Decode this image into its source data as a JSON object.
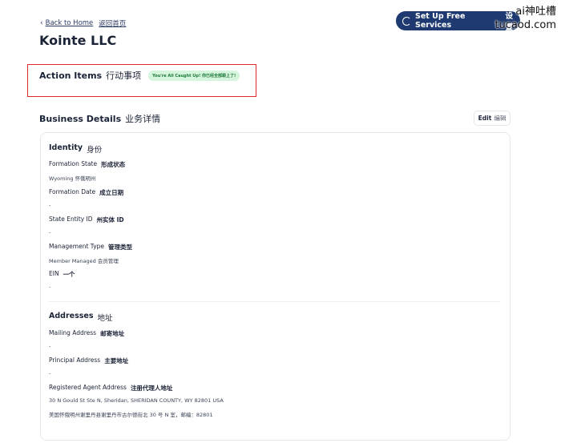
{
  "nav": {
    "back_label": "Back to Home",
    "back_label_cn": "返回首页",
    "back_icon": "chevron-left-icon"
  },
  "page": {
    "title": "Kointe LLC"
  },
  "header_button": {
    "label": "Set Up Free Services",
    "label_cn": "设置",
    "icon": "spinner-icon",
    "color": "#1e3a70"
  },
  "watermark": {
    "line1": "ai神吐槽",
    "line2": "tucaod.com"
  },
  "action_items": {
    "title": "Action Items",
    "title_cn": "行动事项",
    "badge": "You're All Caught Up!  你已经全部跟上了!",
    "highlight_color": "#e0262b",
    "badge_color": "#d6f5dd"
  },
  "business_details": {
    "title": "Business Details",
    "title_cn": "业务详情",
    "edit_label": "Edit",
    "edit_label_cn": "编辑"
  },
  "identity": {
    "title": "Identity",
    "title_cn": "身份",
    "fields": [
      {
        "label": "Formation State",
        "label_cn": "形成状态",
        "value": "Wyoming  怀俄明州"
      },
      {
        "label": "Formation Date",
        "label_cn": "成立日期",
        "value": "-"
      },
      {
        "label": "State Entity ID",
        "label_cn": "州实体 ID",
        "value": "-"
      },
      {
        "label": "Management Type",
        "label_cn": "管理类型",
        "value": "Member Managed  会员管理"
      },
      {
        "label": "EIN",
        "label_cn": "一个",
        "value": "-"
      }
    ]
  },
  "addresses": {
    "title": "Addresses",
    "title_cn": "地址",
    "fields": [
      {
        "label": "Mailing Address",
        "label_cn": "邮寄地址",
        "value": "-"
      },
      {
        "label": "Principal Address",
        "label_cn": "主要地址",
        "value": "-"
      },
      {
        "label": "Registered Agent Address",
        "label_cn": "注册代理人地址",
        "value": "30 N Gould St Ste N, Sheridan, SHERIDAN COUNTY, WY 82801 USA",
        "value2": "美国怀俄明州谢里丹县谢里丹市古尔德街北 30 号 N 室，邮编：82801"
      }
    ]
  }
}
